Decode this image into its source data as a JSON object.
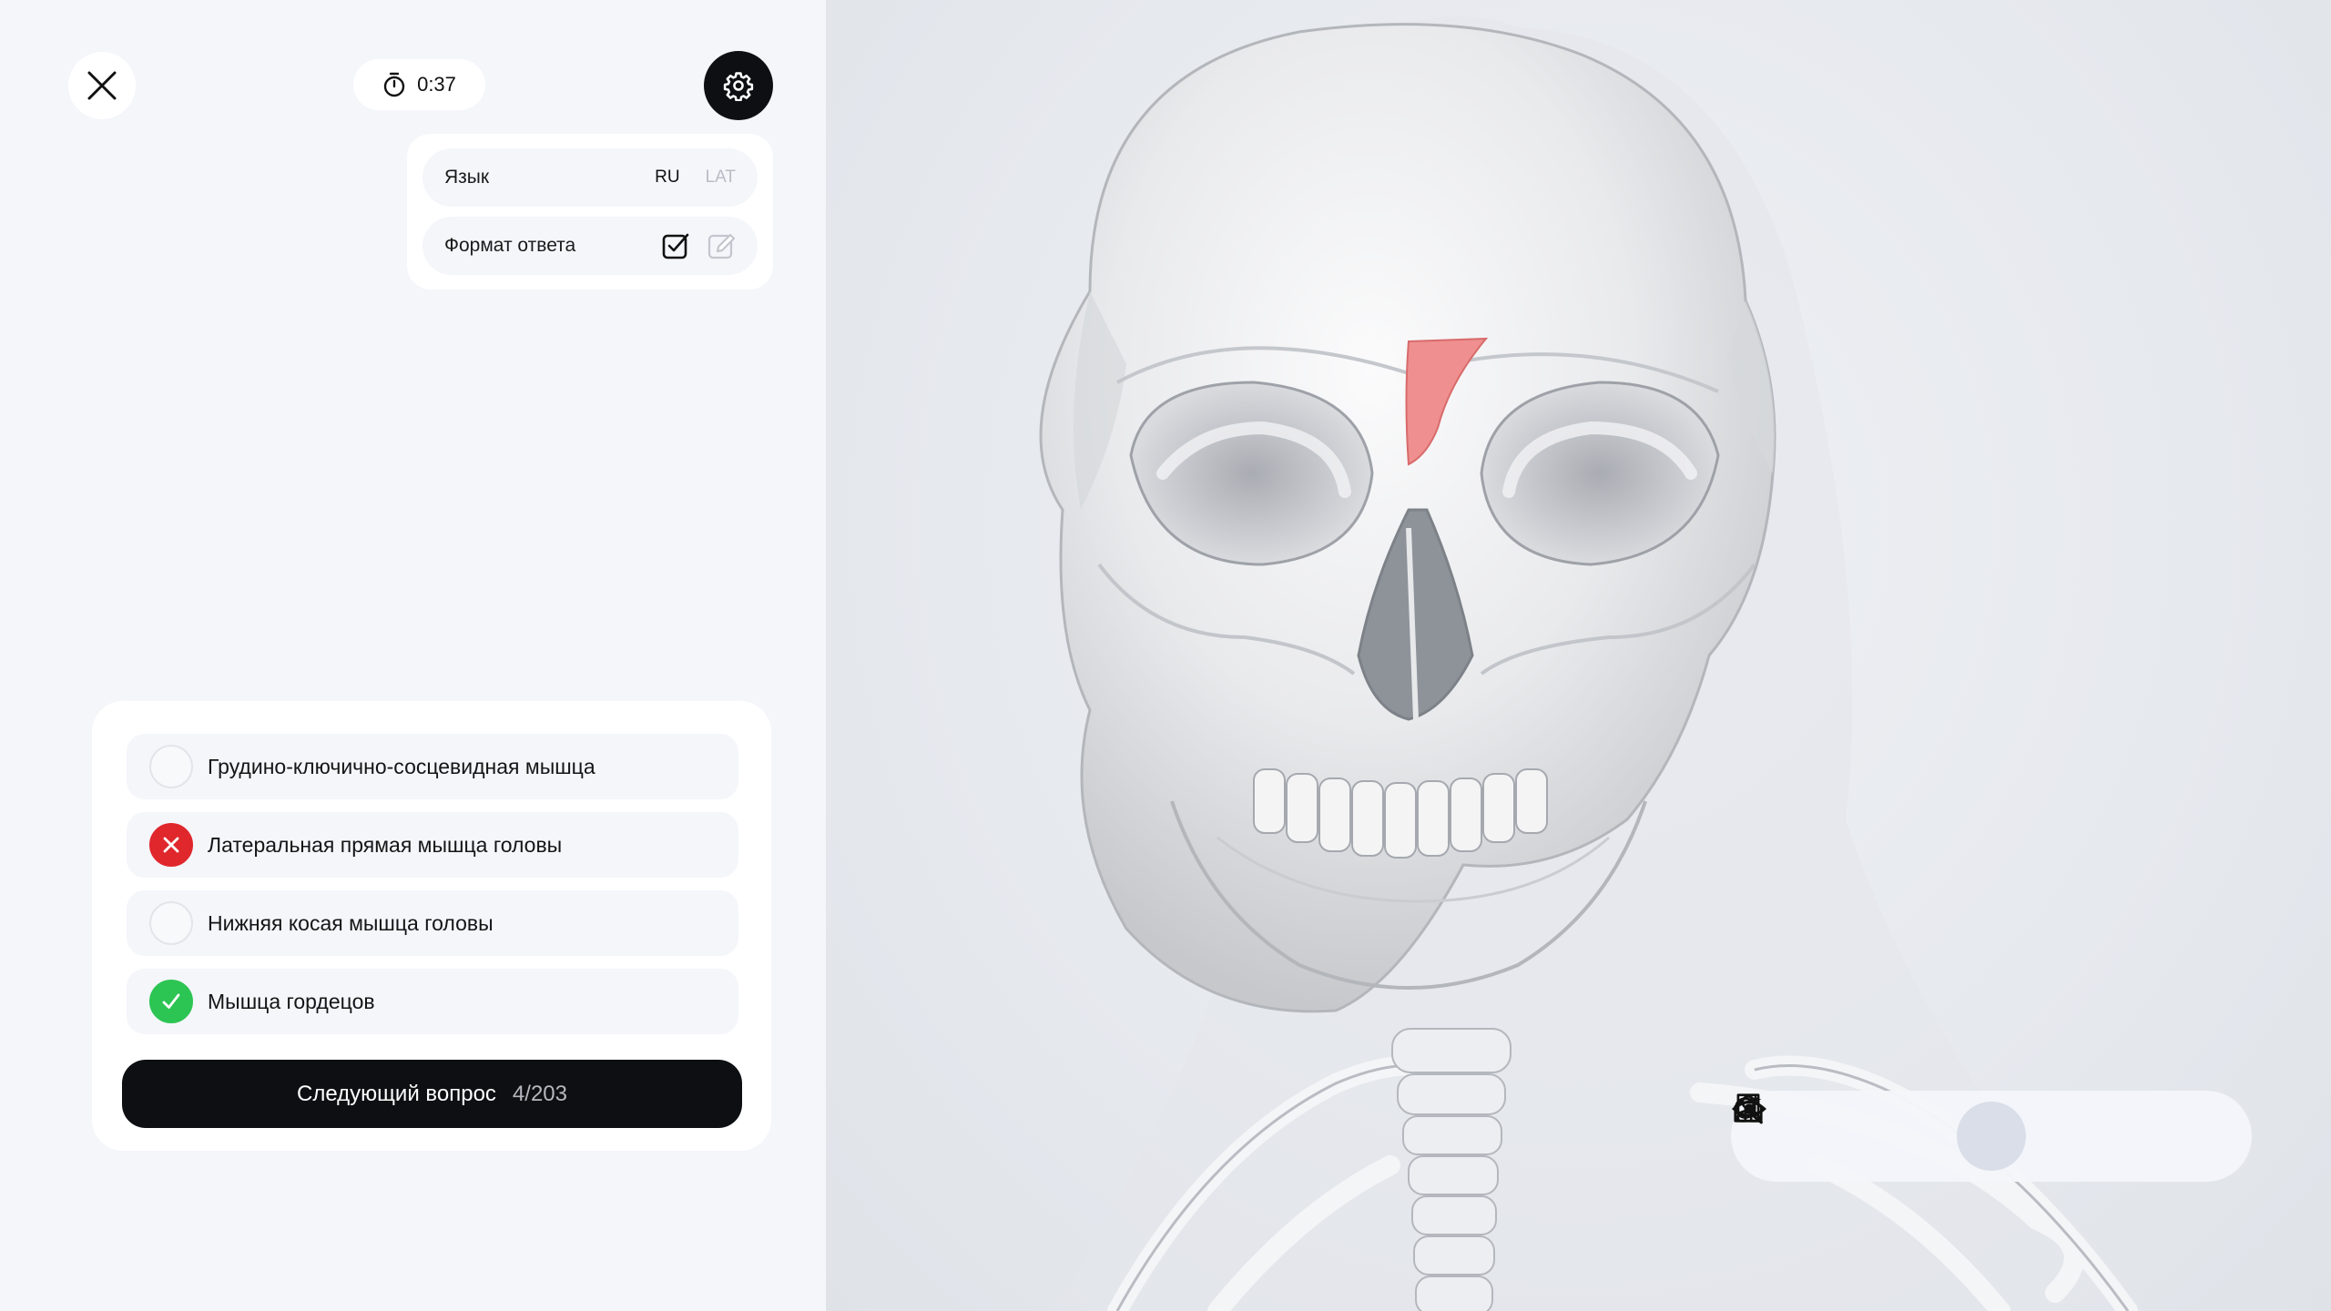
{
  "timer": {
    "value": "0:37"
  },
  "settings": {
    "language_label": "Язык",
    "language_options": [
      "RU",
      "LAT"
    ],
    "language_selected": "RU",
    "answer_format_label": "Формат ответа"
  },
  "quiz": {
    "answers": [
      {
        "label": "Грудино-ключично-сосцевидная мышца",
        "state": "none"
      },
      {
        "label": "Латеральная прямая мышца головы",
        "state": "wrong"
      },
      {
        "label": "Нижняя косая мышца головы",
        "state": "none"
      },
      {
        "label": "Мышца гордецов",
        "state": "correct"
      }
    ],
    "next_label": "Следующий вопрос",
    "progress": "4/203"
  },
  "toolbar": {
    "items": [
      "home-icon",
      "book-icon",
      "eye-icon",
      "search-sparkle-icon",
      "user-icon"
    ],
    "active": "eye-icon"
  },
  "colors": {
    "dark": "#0e0f12",
    "wrong": "#e0272c",
    "correct": "#2cc453",
    "highlight_muscle": "#ef8f8f"
  }
}
